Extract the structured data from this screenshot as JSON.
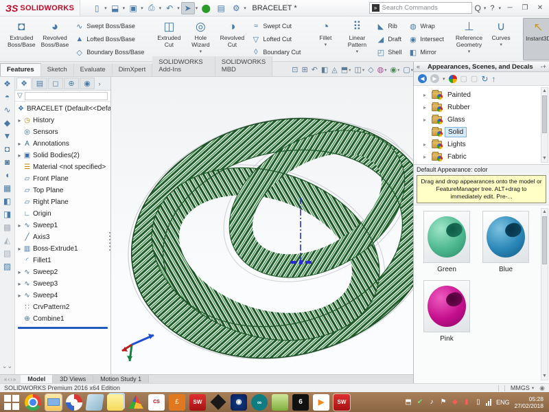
{
  "titlebar": {
    "logo_mark": "ЗS",
    "logo_text": "SOLIDWORKS",
    "document_title": "BRACELET *",
    "search_placeholder": "Search Commands",
    "search_logo_glyph": "»",
    "search_icon": "Q",
    "help_label": "?",
    "minimize_glyph": "─",
    "restore_glyph": "❐",
    "close_glyph": "✕",
    "quick_access": [
      {
        "name": "new-document",
        "glyph": "▯"
      },
      {
        "name": "open-document",
        "glyph": "⬓"
      },
      {
        "name": "save-document",
        "glyph": "▣"
      },
      {
        "name": "print-document",
        "glyph": "⎙"
      },
      {
        "name": "undo",
        "glyph": "↶"
      },
      {
        "name": "select-arrow",
        "glyph": "➤"
      },
      {
        "name": "rebuild",
        "glyph": "⬤"
      },
      {
        "name": "file-properties",
        "glyph": "▤"
      },
      {
        "name": "options-gear",
        "glyph": "⚙"
      }
    ]
  },
  "ribbon": {
    "groups": {
      "g1": {
        "big": [
          {
            "label": "Extruded\nBoss/Base",
            "glyph": "◘"
          },
          {
            "label": "Revolved\nBoss/Base",
            "glyph": "◕"
          }
        ],
        "stack": [
          {
            "label": "Swept Boss/Base",
            "glyph": "∿"
          },
          {
            "label": "Lofted Boss/Base",
            "glyph": "▲"
          },
          {
            "label": "Boundary Boss/Base",
            "glyph": "◇"
          }
        ]
      },
      "g2": {
        "big": [
          {
            "label": "Extruded\nCut",
            "glyph": "◫"
          },
          {
            "label": "Hole\nWizard",
            "glyph": "◎",
            "dd": "▾"
          },
          {
            "label": "Revolved\nCut",
            "glyph": "◑"
          }
        ],
        "stack": [
          {
            "label": "Swept Cut",
            "glyph": "≈"
          },
          {
            "label": "Lofted Cut",
            "glyph": "▽"
          },
          {
            "label": "Boundary Cut",
            "glyph": "◊"
          }
        ]
      },
      "g3": {
        "big": [
          {
            "label": "Fillet",
            "glyph": "◔",
            "dd": "▾"
          },
          {
            "label": "Linear\nPattern",
            "glyph": "⠿",
            "dd": "▾"
          }
        ],
        "stackA": [
          {
            "label": "Rib",
            "glyph": "◣"
          },
          {
            "label": "Draft",
            "glyph": "◢"
          },
          {
            "label": "Shell",
            "glyph": "◰"
          }
        ],
        "stackB": [
          {
            "label": "Wrap",
            "glyph": "◍"
          },
          {
            "label": "Intersect",
            "glyph": "◉"
          },
          {
            "label": "Mirror",
            "glyph": "◧"
          }
        ]
      },
      "g4": {
        "big": [
          {
            "label": "Reference\nGeometry",
            "glyph": "⊥",
            "dd": "▾"
          },
          {
            "label": "Curves",
            "glyph": "∪",
            "dd": "▾"
          }
        ]
      },
      "g5": {
        "big": [
          {
            "label": "Instant3D",
            "glyph": "↖"
          }
        ]
      }
    },
    "tabs": [
      {
        "label": "Features",
        "active": true
      },
      {
        "label": "Sketch"
      },
      {
        "label": "Evaluate"
      },
      {
        "label": "DimXpert"
      },
      {
        "label": "SOLIDWORKS Add-Ins"
      },
      {
        "label": "SOLIDWORKS MBD"
      }
    ]
  },
  "hud_icons": [
    {
      "name": "zoom-to-fit",
      "glyph": "⊡"
    },
    {
      "name": "zoom-to-area",
      "glyph": "⊞"
    },
    {
      "name": "previous-view",
      "glyph": "↶"
    },
    {
      "name": "section-view",
      "glyph": "◧"
    },
    {
      "name": "dynamic-annotation",
      "glyph": "◬"
    },
    {
      "name": "view-orientation",
      "glyph": "⬒",
      "dd": "▾"
    },
    {
      "name": "display-style",
      "glyph": "◫",
      "dd": "▾"
    },
    {
      "name": "hide-show-items",
      "glyph": "◇"
    },
    {
      "name": "edit-appearance",
      "glyph": "◍",
      "dd": "▾"
    },
    {
      "name": "apply-scene",
      "glyph": "◉",
      "dd": "▾"
    },
    {
      "name": "view-settings",
      "glyph": "▢",
      "dd": "▾"
    }
  ],
  "left_toolbar": [
    "❖",
    "◓",
    "∿",
    "◆",
    "▼",
    "◘",
    "◙",
    "◖",
    "▦",
    "◧",
    "◨",
    "▩",
    "◭",
    "▧",
    "▨",
    "◈"
  ],
  "feature_tree": {
    "tabs_glyphs": [
      "❖",
      "▤",
      "◻",
      "⊕",
      "◉"
    ],
    "more_glyph": "›",
    "funnel_glyph": "▽",
    "root": {
      "label": "BRACELET  (Default<<Default>_Display S",
      "glyph": "❖"
    },
    "items": [
      {
        "label": "History",
        "glyph": "◷",
        "arrow": "▸"
      },
      {
        "label": "Sensors",
        "glyph": "◎",
        "arrow": ""
      },
      {
        "label": "Annotations",
        "glyph": "A",
        "arrow": "▸"
      },
      {
        "label": "Solid Bodies(2)",
        "glyph": "▣",
        "arrow": "▸"
      },
      {
        "label": "Material <not specified>",
        "glyph": "☰",
        "arrow": ""
      },
      {
        "label": "Front Plane",
        "glyph": "▱",
        "arrow": ""
      },
      {
        "label": "Top Plane",
        "glyph": "▱",
        "arrow": ""
      },
      {
        "label": "Right Plane",
        "glyph": "▱",
        "arrow": ""
      },
      {
        "label": "Origin",
        "glyph": "∟",
        "arrow": ""
      },
      {
        "label": "Sweep1",
        "glyph": "∿",
        "arrow": "▸"
      },
      {
        "label": "Axis3",
        "glyph": "╱",
        "arrow": ""
      },
      {
        "label": "Boss-Extrude1",
        "glyph": "▥",
        "arrow": "▸"
      },
      {
        "label": "Fillet1",
        "glyph": "◜",
        "arrow": ""
      },
      {
        "label": "Sweep2",
        "glyph": "∿",
        "arrow": "▸"
      },
      {
        "label": "Sweep3",
        "glyph": "∿",
        "arrow": "▸"
      },
      {
        "label": "Sweep4",
        "glyph": "∿",
        "arrow": "▸"
      },
      {
        "label": "CrvPattern2",
        "glyph": "∷",
        "arrow": ""
      },
      {
        "label": "Combine1",
        "glyph": "⊕",
        "arrow": ""
      }
    ]
  },
  "right_panel": {
    "collapse_glyph": "«",
    "title": "Appearances, Scenes, and Decals",
    "pin_glyph": "-+",
    "toolbar": [
      {
        "name": "back",
        "glyph": "◀"
      },
      {
        "name": "forward",
        "glyph": "▶"
      },
      {
        "name": "dropdown",
        "glyph": "▾"
      },
      {
        "name": "refresh",
        "glyph": "↻"
      },
      {
        "name": "up-folder",
        "glyph": "↑"
      }
    ],
    "tree": [
      {
        "label": "Painted",
        "arrow": "▸"
      },
      {
        "label": "Rubber",
        "arrow": "▸"
      },
      {
        "label": "Glass",
        "arrow": "▸"
      },
      {
        "label": "Solid",
        "arrow": "",
        "selected": true
      },
      {
        "label": "Lights",
        "arrow": "▸"
      },
      {
        "label": "Fabric",
        "arrow": "▸"
      }
    ],
    "default_appearance": "Default Appearance: color",
    "tip": "Drag and drop appearances onto the model or FeatureManager tree.  ALT+drag to immediately edit.  Pre-...",
    "swatches": [
      {
        "name": "Green",
        "color": "#4db890"
      },
      {
        "name": "Blue",
        "color": "#2b87b8"
      },
      {
        "name": "Pink",
        "color": "#c50f8e"
      }
    ]
  },
  "bottom_tabs": {
    "nav_glyphs": "«‹›»",
    "tabs": [
      {
        "label": "Model",
        "active": true
      },
      {
        "label": "3D Views"
      },
      {
        "label": "Motion Study 1"
      }
    ]
  },
  "statusbar": {
    "left_text": "SOLIDWORKS Premium 2016 x64 Edition",
    "units": "MMGS",
    "units_dd": "▾",
    "badge_glyph": "◉"
  },
  "taskbar": {
    "apps": {
      "eagle_label": "CS",
      "orange_label": "£",
      "sw_label": "SW",
      "rhino_label": "6",
      "arduino_label": "∞",
      "pot_label": "▶",
      "media_label": "◉"
    },
    "tray": {
      "network_glyph": "⬒",
      "shield_glyph": "✔",
      "volume_glyph": "♪",
      "flag_glyph": "⚑",
      "red_a_glyph": "◆",
      "red_b_glyph": "▮",
      "battery_glyph": "▯",
      "lang": "ENG",
      "time": "05:28",
      "date": "27/02/2018"
    }
  },
  "viewport": {
    "axis_name": "Axis3",
    "model_name": "woven-mobius-bracelet"
  },
  "colors": {
    "accent_red": "#c00a27",
    "model_green": "#1f5c2a",
    "selection_blue": "#7fb3dd",
    "tip_yellow": "#ffffc6",
    "taskbar_brown": "#96714c"
  }
}
